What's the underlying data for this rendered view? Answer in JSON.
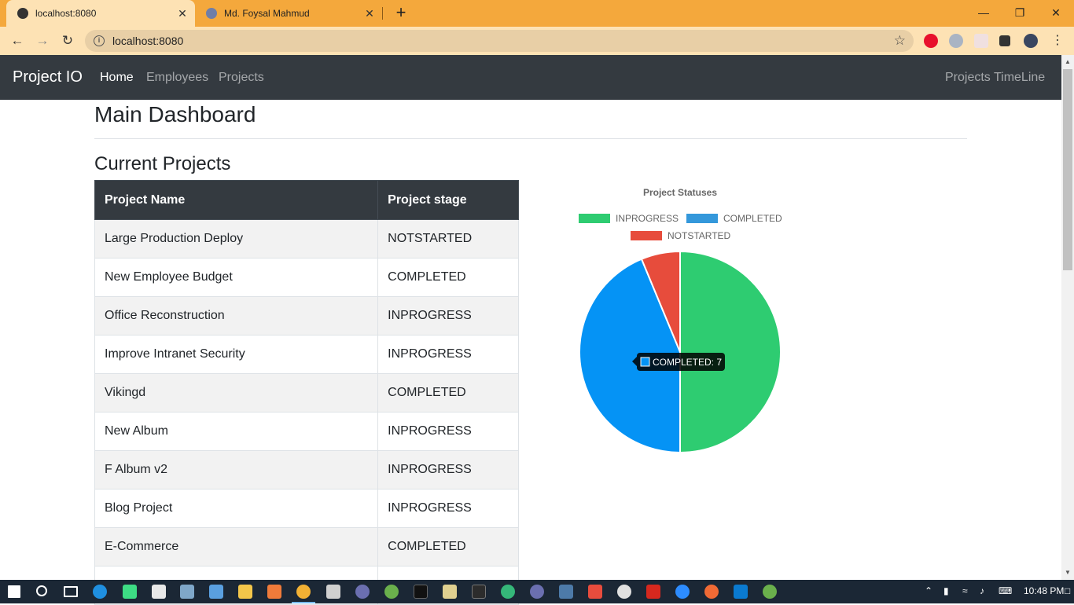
{
  "browser": {
    "tabs": [
      {
        "title": "localhost:8080",
        "active": true
      },
      {
        "title": "Md. Foysal Mahmud",
        "active": false
      }
    ],
    "url": "localhost:8080",
    "controls": {
      "minimize": "—",
      "restore": "❐",
      "close": "✕",
      "new_tab": "+"
    }
  },
  "navbar": {
    "brand": "Project IO",
    "links": [
      {
        "label": "Home",
        "active": true
      },
      {
        "label": "Employees",
        "active": false
      },
      {
        "label": "Projects",
        "active": false
      }
    ],
    "right_link": "Projects TimeLine"
  },
  "page": {
    "title": "Main Dashboard",
    "section_title": "Current Projects"
  },
  "table": {
    "headers": [
      "Project Name",
      "Project stage"
    ],
    "rows": [
      [
        "Large Production Deploy",
        "NOTSTARTED"
      ],
      [
        "New Employee Budget",
        "COMPLETED"
      ],
      [
        "Office Reconstruction",
        "INPROGRESS"
      ],
      [
        "Improve Intranet Security",
        "INPROGRESS"
      ],
      [
        "Vikingd",
        "COMPLETED"
      ],
      [
        "New Album",
        "INPROGRESS"
      ],
      [
        "F Album v2",
        "INPROGRESS"
      ],
      [
        "Blog Project",
        "INPROGRESS"
      ],
      [
        "E-Commerce",
        "COMPLETED"
      ],
      [
        "",
        ""
      ]
    ]
  },
  "chart_data": {
    "type": "pie",
    "title": "Project Statuses",
    "categories": [
      "INPROGRESS",
      "COMPLETED",
      "NOTSTARTED"
    ],
    "values": [
      8,
      7,
      1
    ],
    "colors": [
      "#2ecc71",
      "#0593f5",
      "#e74c3c"
    ],
    "legend_colors": [
      "#2ecc71",
      "#3498db",
      "#e74c3c"
    ],
    "legend_position": "top",
    "tooltip": "COMPLETED: 7"
  },
  "taskbar": {
    "clock": "10:48 PM"
  }
}
